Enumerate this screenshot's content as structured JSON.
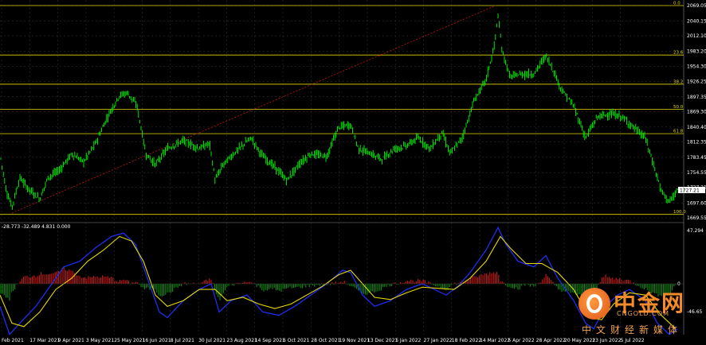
{
  "price_chart": {
    "y_labels": [
      "2069.05",
      "2040.15",
      "2012.10",
      "1983.20",
      "1954.30",
      "1926.25",
      "1897.35",
      "1869.30",
      "1840.40",
      "1812.35",
      "1783.45",
      "1754.55",
      "1727.21",
      "1697.60",
      "1669.55"
    ],
    "current_price": "1727.21",
    "fib_levels": [
      {
        "label": "0.0",
        "price": 2069.05
      },
      {
        "label": "23.6",
        "price": 1976.0
      },
      {
        "label": "38.2",
        "price": 1921.0
      },
      {
        "label": "50.0",
        "price": 1874.0
      },
      {
        "label": "61.8",
        "price": 1828.0
      },
      {
        "label": "100.0",
        "price": 1676.0
      }
    ],
    "colors": {
      "candles": "#00ff00",
      "fib": "#e6d800",
      "trend": "#c81414",
      "grid": "#3a3a3a"
    }
  },
  "indicator": {
    "values_label": "-28.773 -32.489 4.831 0.000",
    "y_labels": [
      "47.294",
      "0",
      "-46.65"
    ],
    "colors": {
      "main": "#1e2ef0",
      "signal": "#e6d800",
      "hist_pos": "#d01818",
      "hist_neg": "#0f8f0f"
    }
  },
  "x_labels": [
    "Feb 2021",
    "17 Mar 2021",
    "9 Apr 2021",
    "3 May 2021",
    "25 May 2021",
    "16 Jun 2021",
    "8 Jul 2021",
    "30 Jul 2021",
    "23 Aug 2021",
    "14 Sep 2021",
    "6 Oct 2021",
    "28 Oct 2021",
    "19 Nov 2021",
    "13 Dec 2021",
    "5 Jan 2022",
    "27 Jan 2022",
    "18 Feb 2022",
    "14 Mar 2022",
    "5 Apr 2022",
    "28 Apr 2022",
    "20 May 2022",
    "13 Jun 2022",
    "5 Jul 2022"
  ],
  "logo": {
    "cn": "中金网",
    "en": "CNGOLD.COM",
    "sub": "中文财经新媒体"
  }
}
